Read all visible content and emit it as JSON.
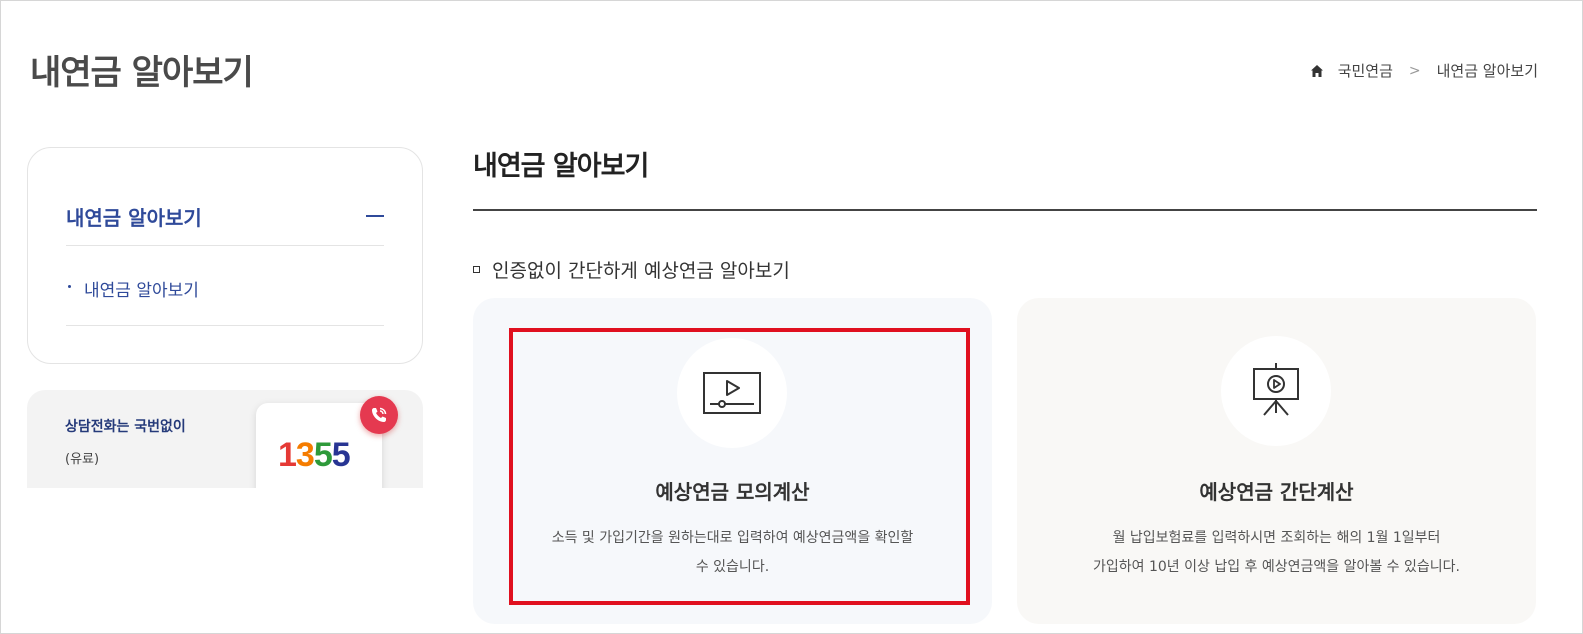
{
  "header": {
    "page_title": "내연금 알아보기",
    "breadcrumb": {
      "home_icon": "home-icon",
      "item1": "국민연금",
      "separator": ">",
      "item2": "내연금 알아보기"
    }
  },
  "sidebar": {
    "menu_title": "내연금 알아보기",
    "toggle_icon": "minus-icon",
    "items": [
      {
        "label": "내연금 알아보기"
      }
    ],
    "phone_banner": {
      "label": "상담전화는 국번없이",
      "sub": "(유료)",
      "number_parts": [
        "1",
        "3",
        "5",
        "5"
      ],
      "number": "1355",
      "icon": "phone-call-icon"
    }
  },
  "main": {
    "title": "내연금 알아보기",
    "section_heading": "인증없이 간단하게 예상연금 알아보기",
    "cards": [
      {
        "icon": "video-player-icon",
        "title": "예상연금 모의계산",
        "desc_line1": "소득 및 가입기간을 원하는대로 입력하여 예상연금액을 확인할",
        "desc_line2": "수 있습니다."
      },
      {
        "icon": "presentation-board-icon",
        "title": "예상연금 간단계산",
        "desc_line1": "월 납입보험료를 입력하시면 조회하는 해의 1월 1일부터",
        "desc_line2": "가입하여 10년 이상 납입 후 예상연금액을 알아볼 수 있습니다."
      }
    ]
  },
  "colors": {
    "accent_blue": "#2f4a9a",
    "highlight_red": "#e0101f"
  }
}
